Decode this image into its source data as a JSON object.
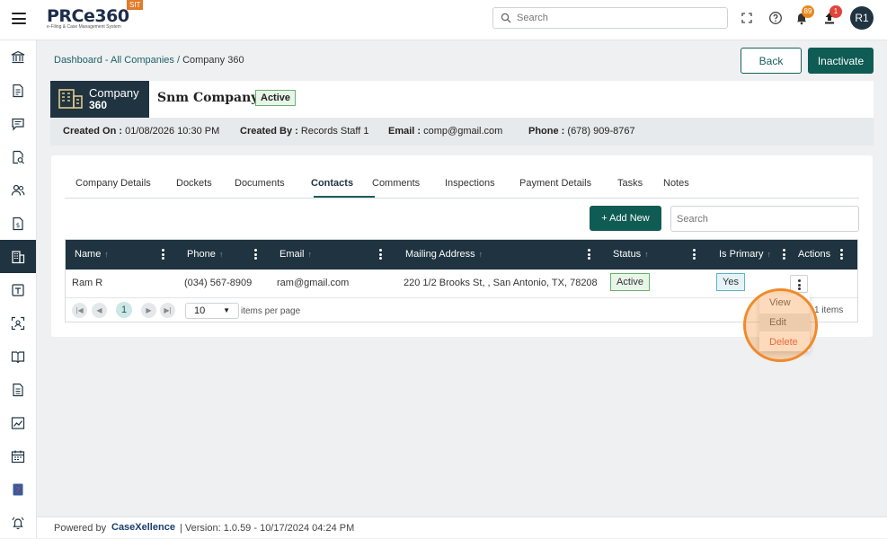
{
  "topbar": {
    "logo_text": "PRCe360",
    "logo_tagline": "e-Filing & Case Management System",
    "env_badge": "SIT",
    "search_placeholder": "Search",
    "notifications_count": "89",
    "uploads_count": "1",
    "avatar_initials": "R1",
    "notif_badge_color": "#e8891f",
    "upload_badge_color": "#e0443a"
  },
  "breadcrumb": {
    "link": "Dashboard - All Companies",
    "separator": " / ",
    "current": "Company 360"
  },
  "actions": {
    "back": "Back",
    "inactivate": "Inactivate"
  },
  "company": {
    "label_line1": "Company",
    "label_line2": "360",
    "name": "Snm Company",
    "status": "Active",
    "created_on_label": "Created On :",
    "created_on": "01/08/2026 10:30 PM",
    "created_by_label": "Created By :",
    "created_by": "Records Staff 1",
    "email_label": "Email :",
    "email": "comp@gmail.com",
    "phone_label": "Phone :",
    "phone": "(678) 909-8767"
  },
  "tabs": [
    {
      "label": "Company Details"
    },
    {
      "label": "Dockets"
    },
    {
      "label": "Documents"
    },
    {
      "label": "Contacts"
    },
    {
      "label": "Comments"
    },
    {
      "label": "Inspections"
    },
    {
      "label": "Payment Details"
    },
    {
      "label": "Tasks"
    },
    {
      "label": "Notes"
    }
  ],
  "active_tab": "Contacts",
  "grid": {
    "add_new": "+ Add New",
    "search_placeholder": "Search",
    "columns": [
      "Name",
      "Phone",
      "Email",
      "Mailing Address",
      "Status",
      "Is Primary",
      "Actions"
    ],
    "rows": [
      {
        "name": "Ram R",
        "phone": "(034) 567-8909",
        "email": "ram@gmail.com",
        "address": "220 1/2 Brooks St, , San Antonio, TX, 78208",
        "status": "Active",
        "is_primary": "Yes"
      }
    ],
    "pager": {
      "current_page": "1",
      "page_size": "10",
      "items_per_page_label": "items per page",
      "items_count_text": "1 items"
    }
  },
  "context_menu": {
    "view": "View",
    "edit": "Edit",
    "delete": "Delete"
  },
  "footer": {
    "powered_by": "Powered by",
    "brand": "CaseXellence",
    "version": "|  Version: 1.0.59 - 10/17/2024 04:24 PM"
  },
  "colors": {
    "primary_dark": "#1f3340",
    "primary_teal": "#0f5c54",
    "highlight": "#f08a2a"
  }
}
